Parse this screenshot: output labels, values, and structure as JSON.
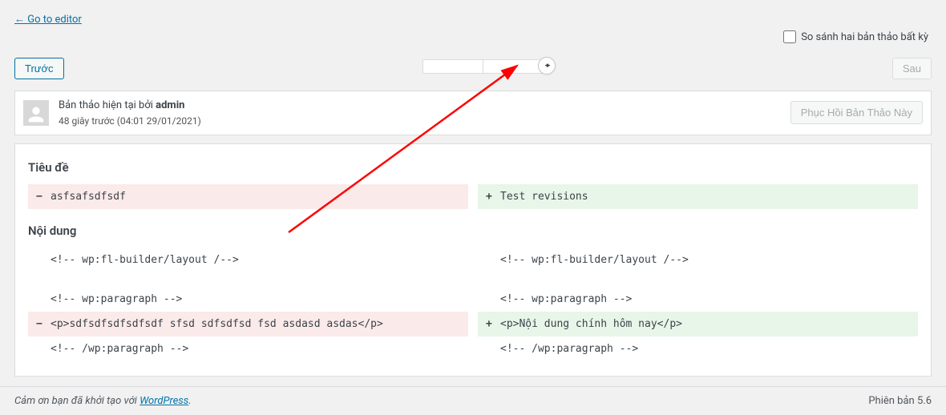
{
  "header": {
    "go_to_editor": "← Go to editor",
    "compare_label": "So sánh hai bản thảo bất kỳ"
  },
  "nav": {
    "prev": "Trước",
    "next": "Sau"
  },
  "meta": {
    "prefix": "Bản thảo hiện tại bởi ",
    "author": "admin",
    "timeago": "48 giây trước (04:01 29/01/2021)",
    "restore": "Phục Hồi Bản Thảo Này"
  },
  "diff": {
    "title_label": "Tiêu đề",
    "content_label": "Nội dung",
    "title_old": "asfsafsdfsdf",
    "title_new": "Test revisions",
    "content_ctx1": "<!-- wp:fl-builder/layout /-->",
    "content_ctx2": "<!-- wp:paragraph -->",
    "content_old": "<p>sdfsdfsdfsdfsdf sfsd sdfsdfsd fsd asdasd asdas</p>",
    "content_new": "<p>Nội dung chính hôm nay</p>",
    "content_ctx3": "<!-- /wp:paragraph -->"
  },
  "footer": {
    "thanks_prefix": "Cảm ơn bạn đã khởi tạo với ",
    "wordpress": "WordPress",
    "thanks_suffix": ".",
    "version": "Phiên bản 5.6"
  }
}
